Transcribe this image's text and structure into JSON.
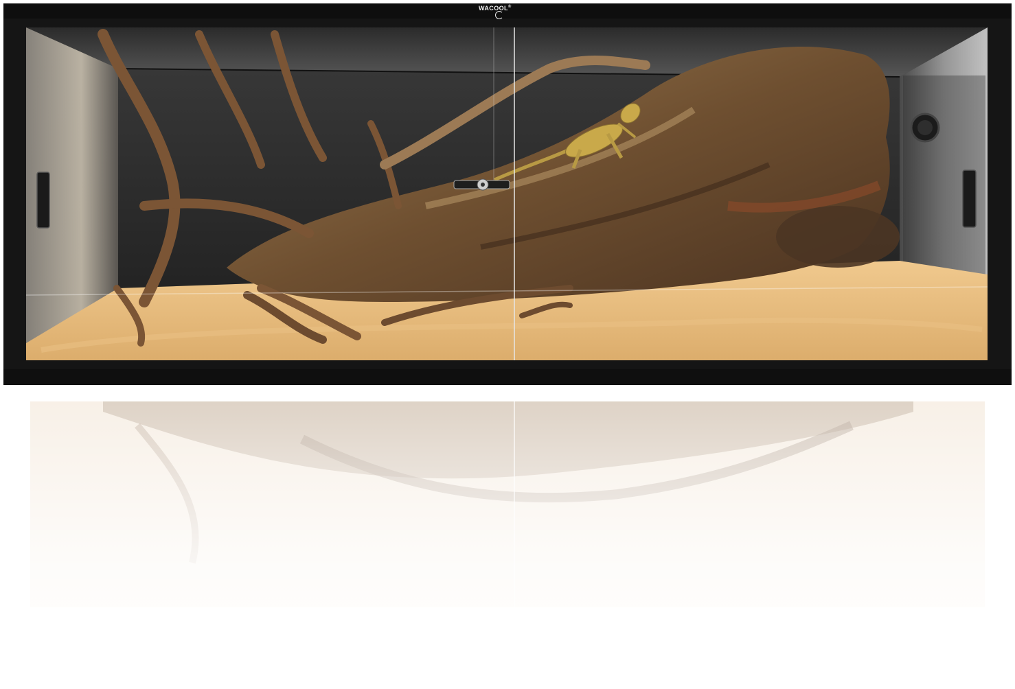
{
  "product": {
    "brand_text": "WACOOL",
    "brand_mark": "®",
    "subject": "terrarium-with-bearded-dragon",
    "colors": {
      "frame": "#151515",
      "background": "#2a2a2a",
      "sand": "#e5b978",
      "wood": "#7a5332",
      "lizard": "#c9a94a",
      "page": "#ffffff"
    }
  }
}
